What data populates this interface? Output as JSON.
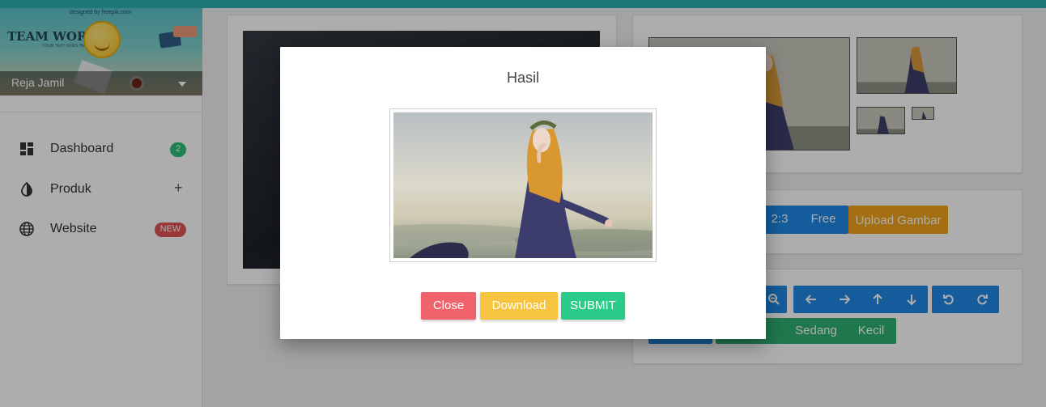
{
  "sidebar": {
    "banner": {
      "credit": "designed by freepik.com",
      "title": "TEAM WORK",
      "subtitle": "YOUR TEXT GOES HERE"
    },
    "user_name": "Reja Jamil",
    "items": [
      {
        "label": "Dashboard",
        "icon": "dashboard-icon",
        "badge": "2",
        "badge_color": "#2bbf77"
      },
      {
        "label": "Produk",
        "icon": "contrast-icon",
        "action": "+"
      },
      {
        "label": "Website",
        "icon": "globe-icon",
        "badge": "NEW",
        "badge_color": "#e15354"
      }
    ]
  },
  "aspect_buttons": [
    "2:3",
    "Free"
  ],
  "upload_label": "Upload Gambar",
  "size_buttons": [
    "Sedang",
    "Kecil"
  ],
  "modal": {
    "title": "Hasil",
    "close_label": "Close",
    "download_label": "Download",
    "submit_label": "SUBMIT"
  },
  "colors": {
    "topbar": "#2db1b4",
    "primary": "#1e88e5",
    "warning": "#f2a21c",
    "success": "#2fb171",
    "close": "#f0636a",
    "download": "#f6c440",
    "submit": "#2bcc8a"
  }
}
